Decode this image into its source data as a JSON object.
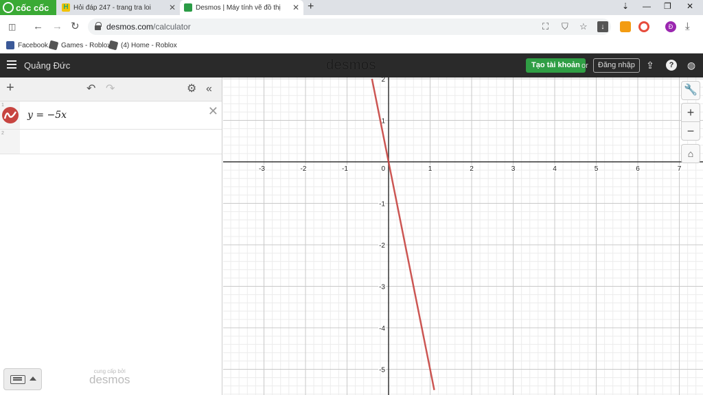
{
  "browser": {
    "brand": "cốc cốc",
    "tabs": [
      {
        "title": "Hỏi đáp 247 - trang tra loi",
        "favicon": "H"
      },
      {
        "title": "Desmos | Máy tính vẽ đồ thị"
      }
    ],
    "url_domain": "desmos.com",
    "url_path": "/calculator",
    "profile_initial": "Đ",
    "bookmarks": [
      "Facebook",
      "Games - Roblox",
      "(4) Home - Roblox"
    ]
  },
  "header": {
    "graph_title": "Quảng Đức",
    "logo": "desmos",
    "create_account": "Tạo tài khoản",
    "or": "or",
    "login": "Đăng nhập",
    "help": "?"
  },
  "expressions": [
    {
      "index": "1",
      "latex": "y = −5x",
      "color": "#c74440"
    },
    {
      "index": "2",
      "latex": ""
    }
  ],
  "footer": {
    "powered_small": "cung cấp bởi",
    "powered_logo": "desmos"
  },
  "graph": {
    "x_ticks": [
      "-3",
      "-2",
      "-1",
      "1",
      "2",
      "3",
      "4",
      "5",
      "6",
      "7"
    ],
    "y_ticks": [
      "2",
      "1",
      "-1",
      "-2",
      "-3",
      "-4",
      "-5"
    ],
    "origin_label": "0"
  },
  "chart_data": {
    "type": "line",
    "series": [
      {
        "values": [
          [
            -0.4,
            2
          ],
          [
            1.1,
            -5.5
          ]
        ],
        "color": "#c74440"
      }
    ],
    "xlim": [
      -4.0,
      7.6
    ],
    "ylim": [
      -5.6,
      2.0
    ],
    "grid": true,
    "xlabel": "",
    "ylabel": ""
  }
}
